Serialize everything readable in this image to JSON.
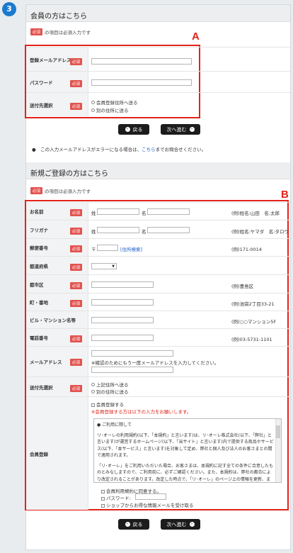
{
  "step": "3",
  "member": {
    "title": "会員の方はこちら",
    "required_badge": "必須",
    "required_note": "の項目は必須入力です",
    "annotation": "A",
    "fields": [
      {
        "label": "登録メールアドレス"
      },
      {
        "label": "パスワード"
      },
      {
        "label": "送付先選択",
        "options": [
          "会員登録住所へ送る",
          "別の住所に送る"
        ]
      }
    ],
    "back_button": "戻る",
    "next_button": "次へ進む",
    "note_before": "この入力メールアドレスがエラーになる場合は、",
    "note_link": "こちら",
    "note_after": "までお問合せください。"
  },
  "new": {
    "title": "新規ご登録の方はこちら",
    "required_note": "の項目は必須入力です",
    "annotation": "B",
    "name": {
      "label": "お名前",
      "sei": "姓",
      "mei": "名",
      "example": "(例)姓名:山田　名:太郎"
    },
    "kana": {
      "label": "フリガナ",
      "sei": "姓",
      "mei": "名",
      "example": "(例)姓名:ヤマダ　名:タロウ"
    },
    "zip": {
      "label": "郵便番号",
      "mark": "〒",
      "search": "[住所検索]",
      "example": "(例)171-0014"
    },
    "pref": {
      "label": "都道府県",
      "select": "▼"
    },
    "city": {
      "label": "都市区",
      "example": "(例)豊島区"
    },
    "street": {
      "label": "町・番地",
      "example": "(例)池袋2丁目33-21"
    },
    "building": {
      "label": "ビル・マンション名等",
      "example": "(例)○○マンション5F"
    },
    "phone": {
      "label": "電話番号",
      "example": "(例)03-5731-1101"
    },
    "email": {
      "label": "メールアドレス",
      "confirm": "※確認のためにもう一度メールアドレスを入力してください。"
    },
    "ship": {
      "label": "送付先選択",
      "options": [
        "上記住所へ送る",
        "別の住所に送る"
      ]
    },
    "register": {
      "label": "会員登録",
      "checkbox": "会員登録する",
      "note": "※会員登録する方は以下の入力をお願いします。",
      "terms_title": "● ご利用に際して",
      "terms_p1": "リ･オーレの利用規約(以下、「本規約」と言います)は、リ･オーレ株式会社(以下、「弊社」と言います)が運営するホームページ(以下、「当サイト」と言います)内で提供する商品やサービス(以下、「本サービス」と言います)を対象して定め、弊社と個人及び法人のお客さまとの間で適用されます。",
      "terms_p2": "「リ･オーレ」をご利用いただいた場合、お客さまは、本規約に記す全ての条件に合意したものとみなしますので、ご利用前に、必ずご確認ください。また、本規約は、弊社の都合により改定されることがあります。改定した時点で、「リ･オーレ」のページ上の情報を更新、または弊社が別に定める方法でお客さまにお知らせいた",
      "agree": "会員利用規約に同意する。",
      "password": "パスワード:",
      "mail": "ショップからお得な情報メールを受け取る"
    },
    "back_button": "戻る",
    "next_button": "次へ進む"
  }
}
